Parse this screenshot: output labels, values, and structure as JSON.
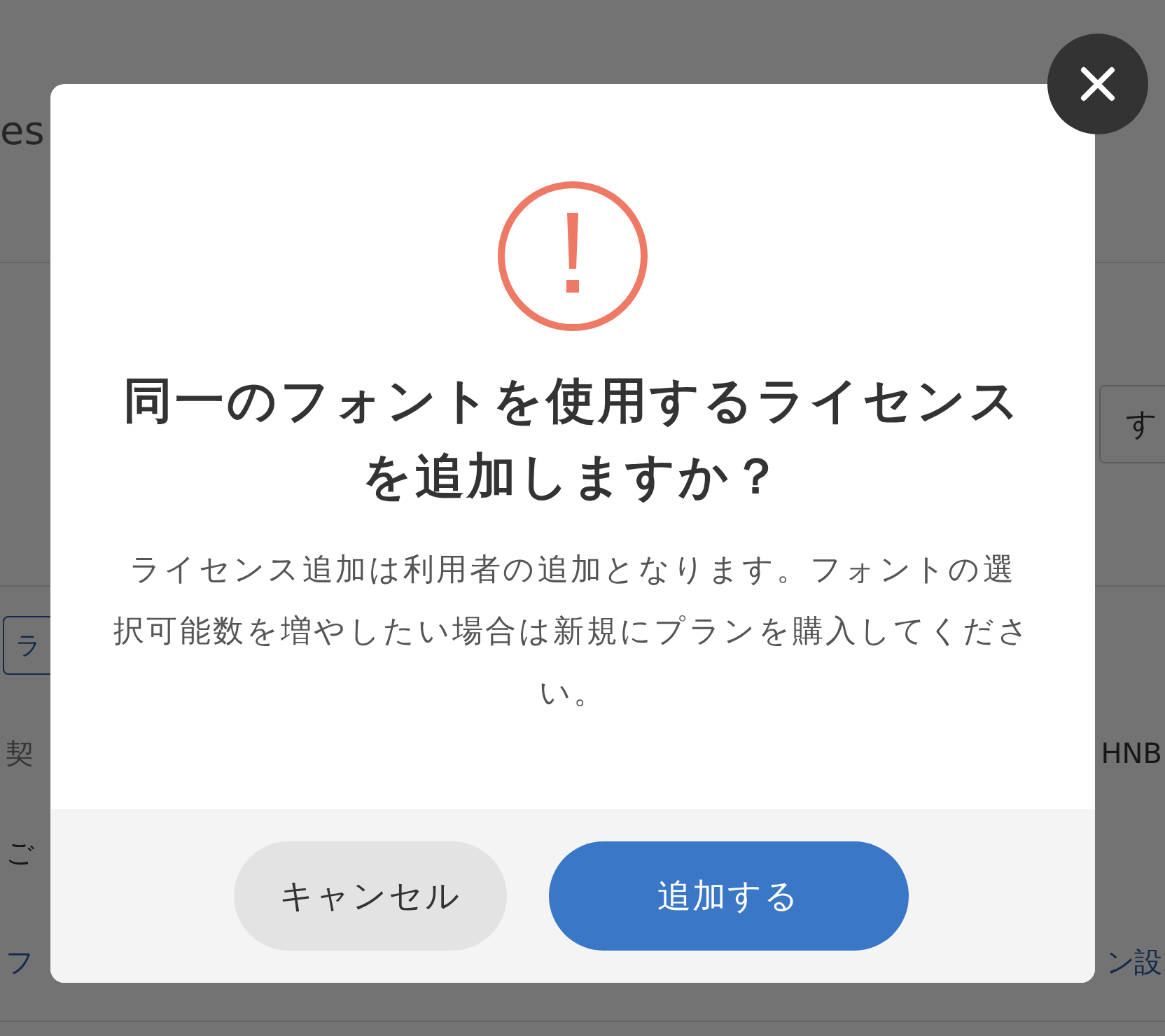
{
  "background": {
    "header_text": "es",
    "action_button": "す",
    "tag_button": "ラ",
    "contract_label": "契",
    "contract_value": "HNB",
    "usage_label": "ご",
    "font_link": "フ",
    "option_link": "ン設"
  },
  "dialog": {
    "title": "同一のフォントを使用するライセンスを追加しますか？",
    "message": "ライセンス追加は利用者の追加となります。フォントの選択可能数を増やしたい場合は新規にプランを購入してください。",
    "buttons": [
      {
        "label": "キャンセル",
        "kind": "secondary"
      },
      {
        "label": "追加する",
        "kind": "primary"
      }
    ]
  }
}
